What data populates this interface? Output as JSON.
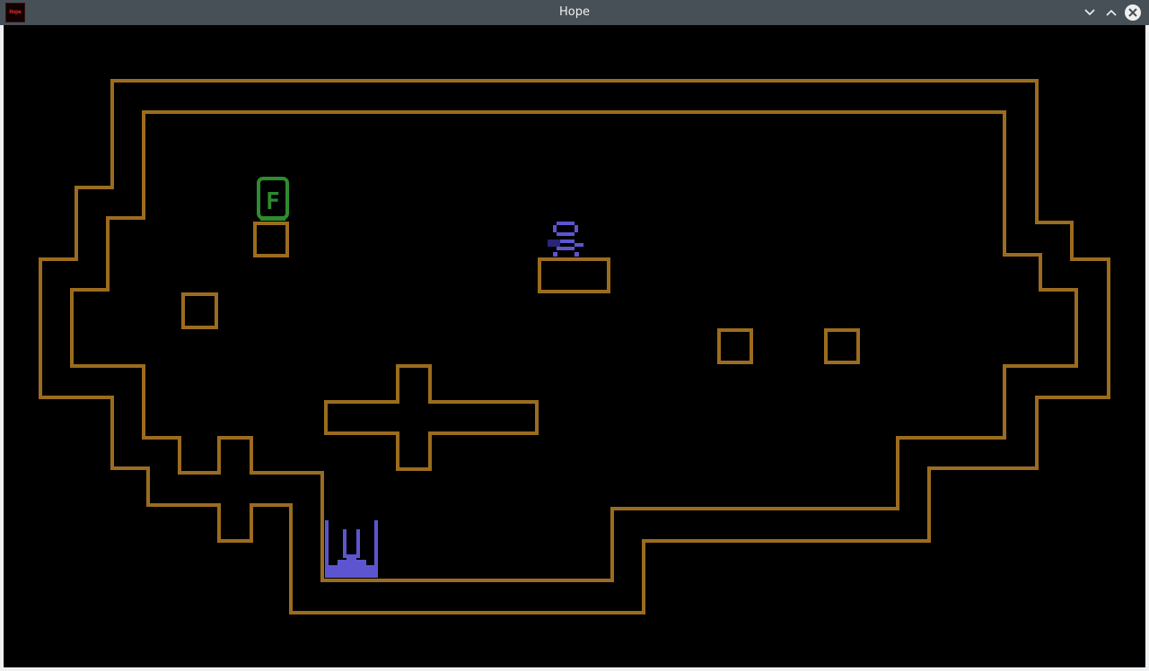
{
  "window": {
    "title": "Hope",
    "app_icon_label": "Hope"
  },
  "titlebar_buttons": [
    {
      "name": "minimize-button",
      "icon": "chevron-down-icon"
    },
    {
      "name": "maximize-button",
      "icon": "chevron-up-icon"
    },
    {
      "name": "close-button",
      "icon": "close-icon"
    }
  ],
  "colors": {
    "titlebar_bg": "#475057",
    "game_bg": "#000000",
    "wall": "#9b6c1f",
    "exit_door": "#2e8b2e",
    "player": "#5d55cf",
    "hazard": "#5d55cf"
  },
  "game": {
    "exit_door_letter": "F"
  }
}
